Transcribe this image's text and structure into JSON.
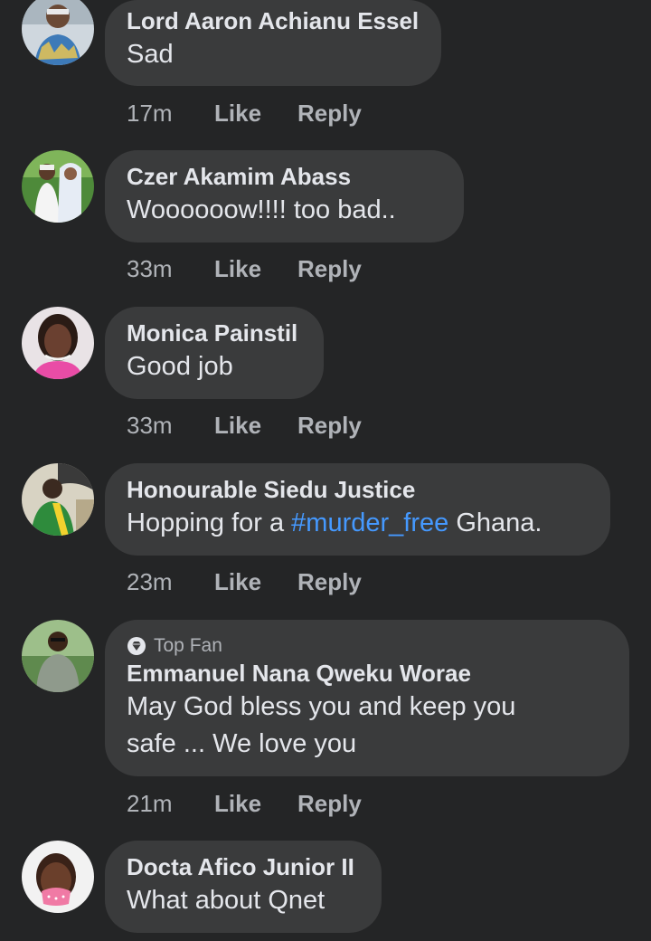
{
  "comments": [
    {
      "author": "Lord Aaron Achianu Essel",
      "text": "Sad",
      "time": "17m",
      "like": "Like",
      "reply": "Reply"
    },
    {
      "author": "Czer Akamim Abass",
      "text": "Woooooow!!!! too bad..",
      "time": "33m",
      "like": "Like",
      "reply": "Reply"
    },
    {
      "author": "Monica Painstil",
      "text": "Good job",
      "time": "33m",
      "like": "Like",
      "reply": "Reply"
    },
    {
      "author": "Honourable Siedu Justice",
      "text_before": "Hopping for a ",
      "hashtag": "#murder_free",
      "text_after": " Ghana.",
      "time": "23m",
      "like": "Like",
      "reply": "Reply"
    },
    {
      "badge": "Top Fan",
      "author": "Emmanuel Nana Qweku Worae",
      "text_line1": "May God bless you and keep you",
      "text_line2": "safe ... We love you",
      "time": "21m",
      "like": "Like",
      "reply": "Reply"
    },
    {
      "author": "Docta Afico Junior II",
      "text": "What about Qnet"
    }
  ],
  "colors": {
    "background": "#242526",
    "bubble": "#3a3b3c",
    "primary_text": "#e4e6eb",
    "secondary_text": "#b0b3b8",
    "hashtag": "#4599ff"
  }
}
